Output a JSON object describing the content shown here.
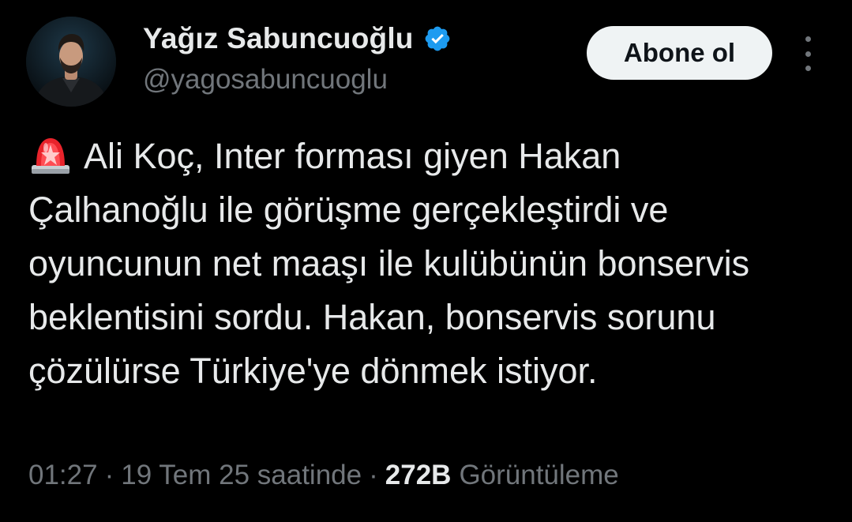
{
  "author": {
    "display_name": "Yağız Sabuncuoğlu",
    "handle": "@yagosabuncuoglu",
    "verified_icon": "verified-badge-icon",
    "avatar_icon": "avatar-photo"
  },
  "actions": {
    "follow_label": "Abone ol",
    "more_icon": "more-options-icon"
  },
  "tweet": {
    "emoji_icon": "police-siren-emoji",
    "text": "Ali Koç, Inter forması giyen Hakan Çalhanoğlu ile görüşme gerçekleştirdi ve oyuncunun net maaşı ile kulübünün bonservis beklentisini sordu. Hakan, bonservis sorunu çözülürse Türkiye'ye dönmek istiyor."
  },
  "meta": {
    "time": "01:27",
    "separator": "·",
    "date": "19 Tem 25 saatinde",
    "views_count": "272B",
    "views_label": "Görüntüleme"
  },
  "colors": {
    "background": "#000000",
    "primary_text": "#e7e9ea",
    "secondary_text": "#71767b",
    "verified_blue": "#1d9bf0",
    "follow_button_bg": "#eff3f4"
  }
}
